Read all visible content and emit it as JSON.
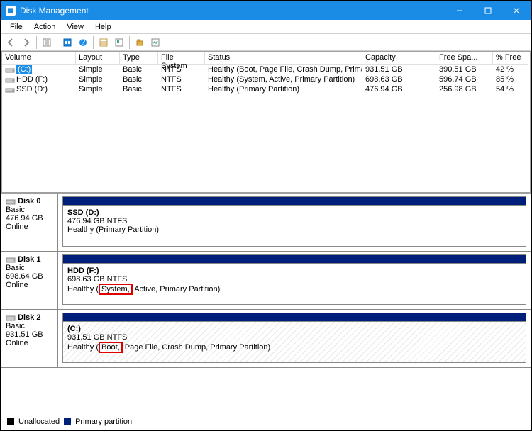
{
  "title": "Disk Management",
  "menu": [
    "File",
    "Action",
    "View",
    "Help"
  ],
  "columns": {
    "vol": "Volume",
    "lay": "Layout",
    "type": "Type",
    "fs": "File System",
    "stat": "Status",
    "cap": "Capacity",
    "free": "Free Spa...",
    "pct": "% Free"
  },
  "volumes": [
    {
      "name": "(C:)",
      "layout": "Simple",
      "type": "Basic",
      "fs": "NTFS",
      "status": "Healthy (Boot, Page File, Crash Dump, Primary ...",
      "capacity": "931.51 GB",
      "free": "390.51 GB",
      "pct": "42 %",
      "selected": true
    },
    {
      "name": "HDD (F:)",
      "layout": "Simple",
      "type": "Basic",
      "fs": "NTFS",
      "status": "Healthy (System, Active, Primary Partition)",
      "capacity": "698.63 GB",
      "free": "596.74 GB",
      "pct": "85 %",
      "selected": false
    },
    {
      "name": "SSD (D:)",
      "layout": "Simple",
      "type": "Basic",
      "fs": "NTFS",
      "status": "Healthy (Primary Partition)",
      "capacity": "476.94 GB",
      "free": "256.98 GB",
      "pct": "54 %",
      "selected": false
    }
  ],
  "disks": [
    {
      "label": "Disk 0",
      "type": "Basic",
      "size": "476.94 GB",
      "state": "Online",
      "part_name": "SSD  (D:)",
      "part_size": "476.94 GB NTFS",
      "part_status_pre": "Healthy (Primary Partition)",
      "red": "",
      "part_status_post": "",
      "hatched": false
    },
    {
      "label": "Disk 1",
      "type": "Basic",
      "size": "698.64 GB",
      "state": "Online",
      "part_name": "HDD  (F:)",
      "part_size": "698.63 GB NTFS",
      "part_status_pre": "Healthy (",
      "red": "System,",
      "part_status_post": " Active, Primary Partition)",
      "hatched": false
    },
    {
      "label": "Disk 2",
      "type": "Basic",
      "size": "931.51 GB",
      "state": "Online",
      "part_name": " (C:)",
      "part_size": "931.51 GB NTFS",
      "part_status_pre": "Healthy (",
      "red": "Boot,",
      "part_status_post": " Page File, Crash Dump, Primary Partition)",
      "hatched": true
    }
  ],
  "legend": {
    "unalloc": "Unallocated",
    "primary": "Primary partition"
  }
}
